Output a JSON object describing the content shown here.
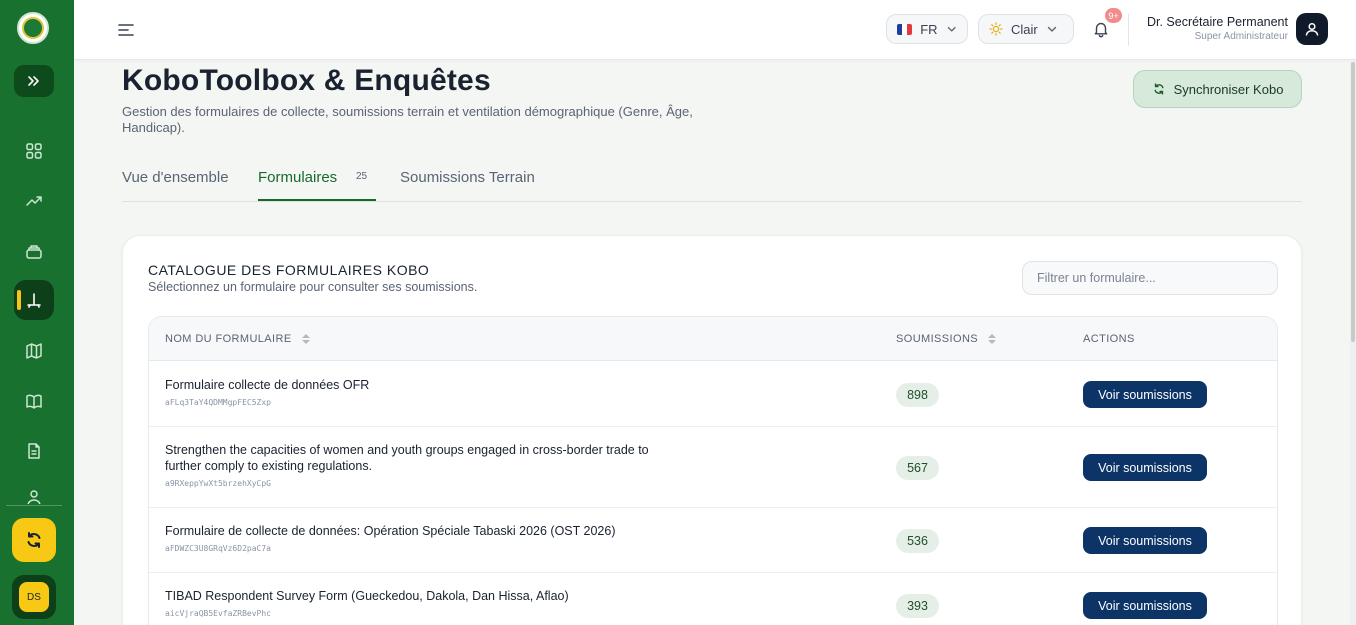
{
  "sidebar": {
    "user_initials": "DS"
  },
  "topbar": {
    "language": "FR",
    "theme": "Clair",
    "notifications_badge": "9+",
    "user_name": "Dr. Secrétaire Permanent",
    "user_role": "Super Administrateur"
  },
  "header": {
    "title": "KoboToolbox & Enquêtes",
    "subtitle": "Gestion des formulaires de collecte, soumissions terrain et ventilation démographique (Genre, Âge, Handicap).",
    "sync_label": "Synchroniser Kobo"
  },
  "tabs": [
    {
      "label": "Vue d'ensemble"
    },
    {
      "label": "Formulaires",
      "count": "25"
    },
    {
      "label": "Soumissions Terrain"
    }
  ],
  "catalog": {
    "title": "CATALOGUE DES FORMULAIRES KOBO",
    "subtitle": "Sélectionnez un formulaire pour consulter ses soumissions.",
    "filter_placeholder": "Filtrer un formulaire...",
    "columns": {
      "name": "NOM DU FORMULAIRE",
      "submissions": "SOUMISSIONS",
      "actions": "ACTIONS"
    },
    "rows": [
      {
        "name": "Formulaire collecte de données OFR",
        "id": "aFLq3TaY4QDMMgpFEC5Zxp",
        "submissions": "898",
        "action": "Voir soumissions"
      },
      {
        "name": "Strengthen the capacities of women and youth groups engaged in cross-border trade to further comply to existing regulations.",
        "id": "a9RXeppYwXt5brzehXyCpG",
        "submissions": "567",
        "action": "Voir soumissions"
      },
      {
        "name": "Formulaire de collecte de données: Opération Spéciale Tabaski 2026 (OST 2026)",
        "id": "aFDWZC3U8GRqVz6D2paC7a",
        "submissions": "536",
        "action": "Voir soumissions"
      },
      {
        "name": "TIBAD Respondent Survey Form (Gueckedou, Dakola, Dan Hissa, Aflao)",
        "id": "aicVjraQB5EvfaZRBevPhc",
        "submissions": "393",
        "action": "Voir soumissions"
      }
    ]
  },
  "colors": {
    "sidebar": "#18712e",
    "accent_yellow": "#f7c814",
    "primary_button": "#0d3467",
    "tab_active": "#176a2c"
  }
}
